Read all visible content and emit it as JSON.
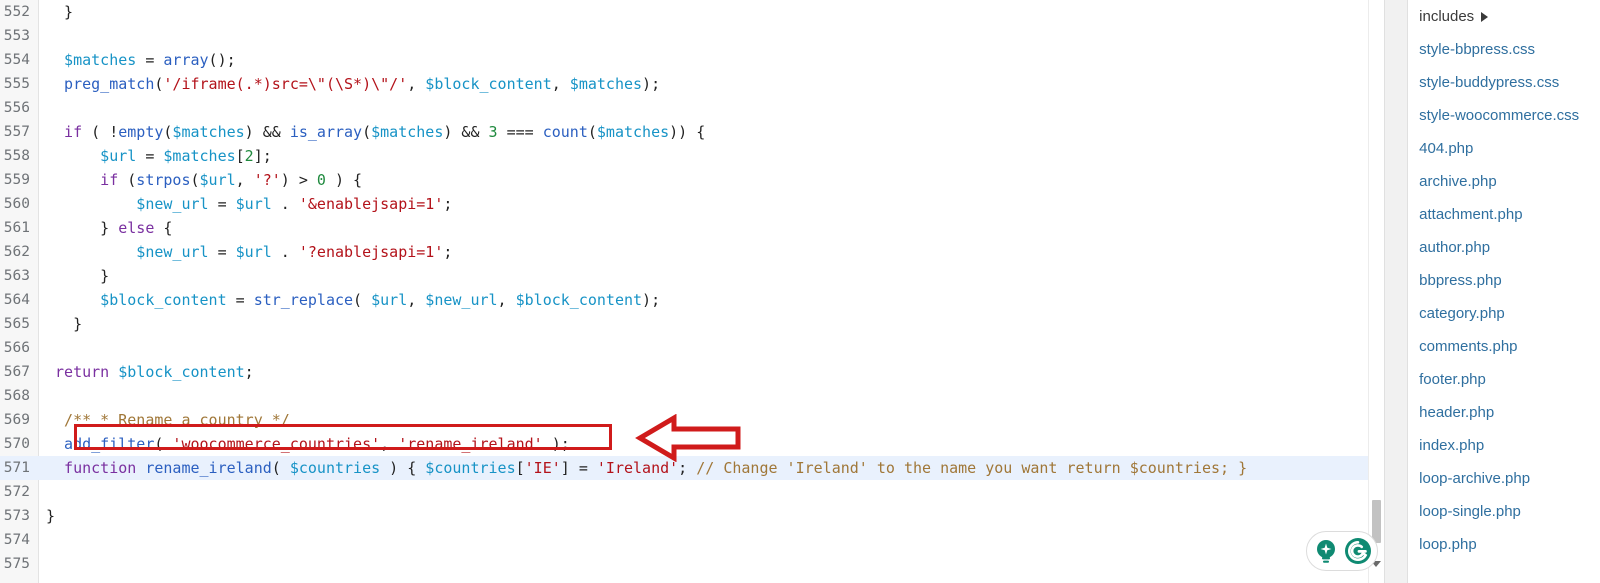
{
  "editor": {
    "first_line": 552,
    "highlighted_line": 571,
    "lines": [
      {
        "n": 552,
        "indent": 2,
        "tokens": [
          {
            "t": "}",
            "c": "pln"
          }
        ]
      },
      {
        "n": 553,
        "indent": 0,
        "tokens": []
      },
      {
        "n": 554,
        "indent": 2,
        "tokens": [
          {
            "t": "$matches",
            "c": "var"
          },
          {
            "t": " = ",
            "c": "op"
          },
          {
            "t": "array",
            "c": "fn"
          },
          {
            "t": "();",
            "c": "pln"
          }
        ]
      },
      {
        "n": 555,
        "indent": 2,
        "tokens": [
          {
            "t": "preg_match",
            "c": "fn"
          },
          {
            "t": "(",
            "c": "pln"
          },
          {
            "t": "'/iframe(.*)src=\\\"(\\S*)\\\"/'",
            "c": "str"
          },
          {
            "t": ", ",
            "c": "pln"
          },
          {
            "t": "$block_content",
            "c": "var"
          },
          {
            "t": ", ",
            "c": "pln"
          },
          {
            "t": "$matches",
            "c": "var"
          },
          {
            "t": ");",
            "c": "pln"
          }
        ]
      },
      {
        "n": 556,
        "indent": 0,
        "tokens": []
      },
      {
        "n": 557,
        "indent": 2,
        "tokens": [
          {
            "t": "if",
            "c": "kw"
          },
          {
            "t": " ( !",
            "c": "pln"
          },
          {
            "t": "empty",
            "c": "fn"
          },
          {
            "t": "(",
            "c": "pln"
          },
          {
            "t": "$matches",
            "c": "var"
          },
          {
            "t": ") && ",
            "c": "pln"
          },
          {
            "t": "is_array",
            "c": "fn"
          },
          {
            "t": "(",
            "c": "pln"
          },
          {
            "t": "$matches",
            "c": "var"
          },
          {
            "t": ") && ",
            "c": "pln"
          },
          {
            "t": "3",
            "c": "num"
          },
          {
            "t": " === ",
            "c": "pln"
          },
          {
            "t": "count",
            "c": "fn"
          },
          {
            "t": "(",
            "c": "pln"
          },
          {
            "t": "$matches",
            "c": "var"
          },
          {
            "t": ")) {",
            "c": "pln"
          }
        ]
      },
      {
        "n": 558,
        "indent": 6,
        "tokens": [
          {
            "t": "$url",
            "c": "var"
          },
          {
            "t": " = ",
            "c": "op"
          },
          {
            "t": "$matches",
            "c": "var"
          },
          {
            "t": "[",
            "c": "pln"
          },
          {
            "t": "2",
            "c": "num"
          },
          {
            "t": "];",
            "c": "pln"
          }
        ]
      },
      {
        "n": 559,
        "indent": 6,
        "tokens": [
          {
            "t": "if",
            "c": "kw"
          },
          {
            "t": " (",
            "c": "pln"
          },
          {
            "t": "strpos",
            "c": "fn"
          },
          {
            "t": "(",
            "c": "pln"
          },
          {
            "t": "$url",
            "c": "var"
          },
          {
            "t": ", ",
            "c": "pln"
          },
          {
            "t": "'?'",
            "c": "str"
          },
          {
            "t": ") > ",
            "c": "pln"
          },
          {
            "t": "0",
            "c": "num"
          },
          {
            "t": " ) {",
            "c": "pln"
          }
        ]
      },
      {
        "n": 560,
        "indent": 10,
        "tokens": [
          {
            "t": "$new_url",
            "c": "var"
          },
          {
            "t": " = ",
            "c": "op"
          },
          {
            "t": "$url",
            "c": "var"
          },
          {
            "t": " . ",
            "c": "pln"
          },
          {
            "t": "'&enablejsapi=1'",
            "c": "str"
          },
          {
            "t": ";",
            "c": "pln"
          }
        ]
      },
      {
        "n": 561,
        "indent": 6,
        "tokens": [
          {
            "t": "} ",
            "c": "pln"
          },
          {
            "t": "else",
            "c": "kw"
          },
          {
            "t": " {",
            "c": "pln"
          }
        ]
      },
      {
        "n": 562,
        "indent": 10,
        "tokens": [
          {
            "t": "$new_url",
            "c": "var"
          },
          {
            "t": " = ",
            "c": "op"
          },
          {
            "t": "$url",
            "c": "var"
          },
          {
            "t": " . ",
            "c": "pln"
          },
          {
            "t": "'?enablejsapi=1'",
            "c": "str"
          },
          {
            "t": ";",
            "c": "pln"
          }
        ]
      },
      {
        "n": 563,
        "indent": 6,
        "tokens": [
          {
            "t": "}",
            "c": "pln"
          }
        ]
      },
      {
        "n": 564,
        "indent": 6,
        "tokens": [
          {
            "t": "$block_content",
            "c": "var"
          },
          {
            "t": " = ",
            "c": "op"
          },
          {
            "t": "str_replace",
            "c": "fn"
          },
          {
            "t": "( ",
            "c": "pln"
          },
          {
            "t": "$url",
            "c": "var"
          },
          {
            "t": ", ",
            "c": "pln"
          },
          {
            "t": "$new_url",
            "c": "var"
          },
          {
            "t": ", ",
            "c": "pln"
          },
          {
            "t": "$block_content",
            "c": "var"
          },
          {
            "t": ");",
            "c": "pln"
          }
        ]
      },
      {
        "n": 565,
        "indent": 3,
        "tokens": [
          {
            "t": "}",
            "c": "pln"
          }
        ]
      },
      {
        "n": 566,
        "indent": 0,
        "tokens": []
      },
      {
        "n": 567,
        "indent": 1,
        "tokens": [
          {
            "t": "return",
            "c": "kw"
          },
          {
            "t": " ",
            "c": "pln"
          },
          {
            "t": "$block_content",
            "c": "var"
          },
          {
            "t": ";",
            "c": "pln"
          }
        ]
      },
      {
        "n": 568,
        "indent": 0,
        "tokens": []
      },
      {
        "n": 569,
        "indent": 2,
        "tokens": [
          {
            "t": "/** * Rename a country */",
            "c": "com"
          }
        ]
      },
      {
        "n": 570,
        "indent": 2,
        "tokens": [
          {
            "t": "add_filter",
            "c": "fn"
          },
          {
            "t": "( ",
            "c": "pln"
          },
          {
            "t": "'woocommerce_countries'",
            "c": "str"
          },
          {
            "t": ", ",
            "c": "pln"
          },
          {
            "t": "'rename_ireland'",
            "c": "str"
          },
          {
            "t": " );",
            "c": "pln"
          }
        ]
      },
      {
        "n": 571,
        "indent": 2,
        "tokens": [
          {
            "t": "function",
            "c": "kw"
          },
          {
            "t": " ",
            "c": "pln"
          },
          {
            "t": "rename_ireland",
            "c": "fn"
          },
          {
            "t": "( ",
            "c": "pln"
          },
          {
            "t": "$countries",
            "c": "var"
          },
          {
            "t": " ) { ",
            "c": "pln"
          },
          {
            "t": "$countries",
            "c": "var"
          },
          {
            "t": "[",
            "c": "pln"
          },
          {
            "t": "'IE'",
            "c": "str"
          },
          {
            "t": "] = ",
            "c": "pln"
          },
          {
            "t": "'Ireland'",
            "c": "str"
          },
          {
            "t": "; ",
            "c": "pln"
          },
          {
            "t": "// Change 'Ireland' to the name you want return $countries; }",
            "c": "com"
          }
        ]
      },
      {
        "n": 572,
        "indent": 0,
        "tokens": []
      },
      {
        "n": 573,
        "indent": 0,
        "tokens": [
          {
            "t": "}",
            "c": "pln"
          }
        ]
      },
      {
        "n": 574,
        "indent": 0,
        "tokens": []
      },
      {
        "n": 575,
        "indent": 0,
        "tokens": []
      }
    ],
    "annotation": {
      "box_color": "#d01b1b",
      "arrow_color": "#d01b1b",
      "boxed_code": "add_filter( 'woocommerce_countries', 'rename_ireland' );"
    },
    "scrollbar": {
      "thumb_color": "#c2c2c2"
    }
  },
  "grammarly": {
    "bulb_label": "grammarly-suggestion-bulb",
    "logo_label": "grammarly-logo",
    "accent": "#0f8a72"
  },
  "file_panel": {
    "items": [
      {
        "label": "includes",
        "type": "folder"
      },
      {
        "label": "style-bbpress.css",
        "type": "file"
      },
      {
        "label": "style-buddypress.css",
        "type": "file"
      },
      {
        "label": "style-woocommerce.css",
        "type": "file"
      },
      {
        "label": "404.php",
        "type": "file"
      },
      {
        "label": "archive.php",
        "type": "file"
      },
      {
        "label": "attachment.php",
        "type": "file"
      },
      {
        "label": "author.php",
        "type": "file"
      },
      {
        "label": "bbpress.php",
        "type": "file"
      },
      {
        "label": "category.php",
        "type": "file"
      },
      {
        "label": "comments.php",
        "type": "file"
      },
      {
        "label": "footer.php",
        "type": "file"
      },
      {
        "label": "header.php",
        "type": "file"
      },
      {
        "label": "index.php",
        "type": "file"
      },
      {
        "label": "loop-archive.php",
        "type": "file"
      },
      {
        "label": "loop-single.php",
        "type": "file"
      },
      {
        "label": "loop.php",
        "type": "file"
      }
    ],
    "link_color": "#2f6f9f"
  }
}
